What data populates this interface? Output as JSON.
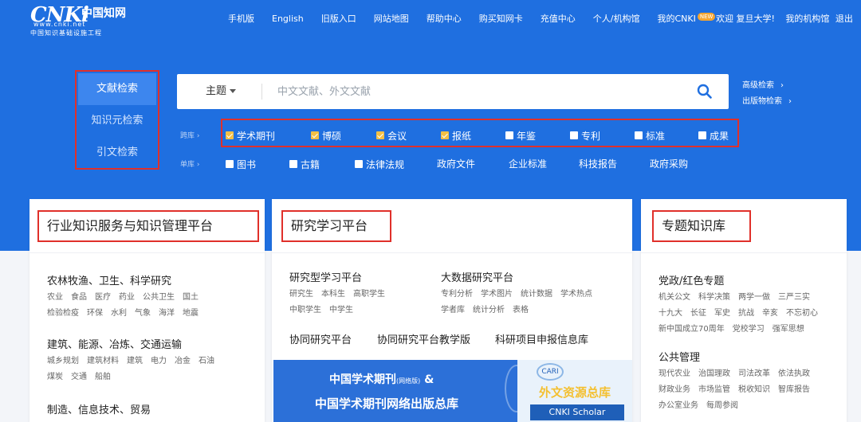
{
  "logo": {
    "mark": "CNKi",
    "cn_mark": "中国知网",
    "url": "www.cnki.net",
    "subtitle": "中国知识基础设施工程"
  },
  "topnav": {
    "items": [
      "手机版",
      "English",
      "旧版入口",
      "网站地图",
      "帮助中心",
      "购买知网卡",
      "充值中心",
      "个人/机构馆",
      "我的CNKI"
    ],
    "new_badge": "NEW"
  },
  "user": {
    "welcome": "欢迎 复旦大学!",
    "my_org": "我的机构馆",
    "logout": "退出"
  },
  "left_tabs": [
    "文献检索",
    "知识元检索",
    "引文检索"
  ],
  "search": {
    "scope": "主题",
    "placeholder": "中文文献、外文文献"
  },
  "advanced": {
    "advanced_search": "高级检索",
    "publication_search": "出版物检索"
  },
  "db_rows": {
    "row1_label": "跨库",
    "row1": [
      {
        "label": "学术期刊",
        "checked": true
      },
      {
        "label": "博硕",
        "checked": true
      },
      {
        "label": "会议",
        "checked": true
      },
      {
        "label": "报纸",
        "checked": true
      },
      {
        "label": "年鉴",
        "checked": false
      },
      {
        "label": "专利",
        "checked": false
      },
      {
        "label": "标准",
        "checked": false
      },
      {
        "label": "成果",
        "checked": false
      }
    ],
    "row2_label": "单库",
    "row2_checks": [
      {
        "label": "图书",
        "checked": false
      },
      {
        "label": "古籍",
        "checked": false
      },
      {
        "label": "法律法规",
        "checked": false
      }
    ],
    "row2_plain": [
      "政府文件",
      "企业标准",
      "科技报告",
      "政府采购"
    ]
  },
  "card1": {
    "title": "行业知识服务与知识管理平台",
    "sec1": "农林牧渔、卫生、科学研究",
    "tags1a": [
      "农业",
      "食品",
      "医疗",
      "药业",
      "公共卫生",
      "国土"
    ],
    "tags1b": [
      "检验检疫",
      "环保",
      "水利",
      "气象",
      "海洋",
      "地震"
    ],
    "sec2": "建筑、能源、冶炼、交通运输",
    "tags2a": [
      "城乡规划",
      "建筑材料",
      "建筑",
      "电力",
      "冶金",
      "石油"
    ],
    "tags2b": [
      "煤炭",
      "交通",
      "船舶"
    ],
    "sec3": "制造、信息技术、贸易"
  },
  "card2": {
    "title": "研究学习平台",
    "sec_left": "研究型学习平台",
    "sec_right": "大数据研究平台",
    "tags_left_a": [
      "研究生",
      "本科生",
      "高职学生"
    ],
    "tags_left_b": [
      "中职学生",
      "中学生"
    ],
    "tags_right_a": [
      "专利分析",
      "学术图片",
      "统计数据",
      "学术热点"
    ],
    "tags_right_b": [
      "学者库",
      "统计分析",
      "表格"
    ],
    "links": [
      "协同研究平台",
      "协同研究平台教学版",
      "科研项目申报信息库"
    ]
  },
  "banner": {
    "line1": "中国学术期刊",
    "line1_small": "(网络版)",
    "line1_suffix": "&",
    "line2": "中国学术期刊网络出版总库",
    "cari": "CARI",
    "waiwen": "外文资源总库",
    "scholar": "CNKI Scholar"
  },
  "card3": {
    "title": "专题知识库",
    "sec1": "党政/红色专题",
    "tags1a": [
      "机关公文",
      "科学决策",
      "两学一做",
      "三严三实"
    ],
    "tags1b": [
      "十九大",
      "长征",
      "军史",
      "抗战",
      "辛亥",
      "不忘初心"
    ],
    "tags1c": [
      "新中国成立70周年",
      "党校学习",
      "强军思想"
    ],
    "sec2": "公共管理",
    "tags2a": [
      "现代农业",
      "治国理政",
      "司法改革",
      "依法执政"
    ],
    "tags2b": [
      "财政业务",
      "市场监管",
      "税收知识",
      "智库报告"
    ],
    "tags2c": [
      "办公室业务",
      "每周参阅"
    ]
  },
  "colors": {
    "header_blue": "#1f6fe0",
    "highlight_red": "#e0302a",
    "checked_yellow": "#f3c046"
  }
}
